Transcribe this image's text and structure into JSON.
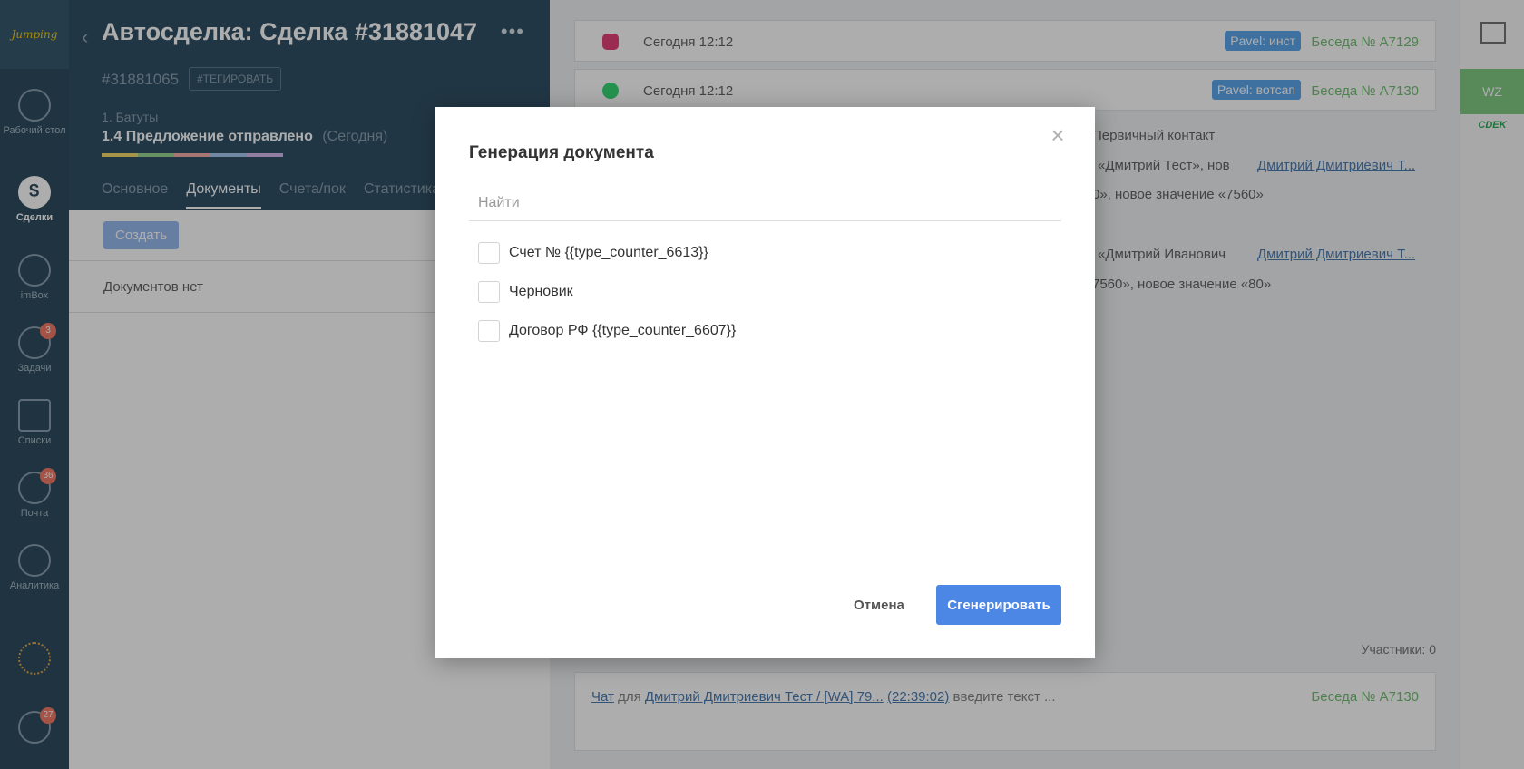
{
  "nav": {
    "logo": "Jumping",
    "items": [
      {
        "label": "Рабочий стол",
        "icon": "dashboard-icon"
      },
      {
        "label": "Сделки",
        "icon": "deals-icon",
        "active": true
      },
      {
        "label": "imBox",
        "icon": "chat-icon"
      },
      {
        "label": "Задачи",
        "icon": "tasks-icon",
        "badge": "3"
      },
      {
        "label": "Списки",
        "icon": "lists-icon"
      },
      {
        "label": "Почта",
        "icon": "mail-icon",
        "badge": "36"
      },
      {
        "label": "Аналитика",
        "icon": "analytics-icon"
      },
      {
        "label": "",
        "icon": "more-icon"
      },
      {
        "label": "",
        "icon": "notifications-icon",
        "badge": "27"
      }
    ]
  },
  "deal": {
    "title": "Автосделка: Сделка #31881047",
    "id": "#31881065",
    "tag_button": "#ТЕГИРОВАТЬ",
    "pipeline": "1. Батуты",
    "stage": "1.4 Предложение отправлено",
    "stage_date": "(Сегодня)",
    "stage_colors": [
      "#f2d55b",
      "#8ed08a",
      "#f4a7a0",
      "#9ec3ef",
      "#d6b3ef"
    ],
    "tabs": [
      "Основное",
      "Документы",
      "Счета/пок",
      "Статистика"
    ],
    "active_tab": "Документы",
    "create_button": "Создать",
    "no_documents": "Документов нет"
  },
  "feed": {
    "rows": [
      {
        "time": "Сегодня 12:12",
        "tag": "Pavel: инст",
        "conversation": "Беседа № A7129",
        "icon": "instagram-icon"
      },
      {
        "time": "Сегодня 12:12",
        "tag": "Pavel: вотсап",
        "conversation": "Беседа № A7130",
        "icon": "whatsapp-icon"
      }
    ],
    "background_texts": {
      "primary_contact": "Первичный контакт",
      "value1": "«Дмитрий Тест», нов",
      "person1": "Дмитрий Дмитриевич Т...",
      "change1": "0», новое значение «7560»",
      "value2": "«Дмитрий Иванович",
      "person2": "Дмитрий Дмитриевич Т...",
      "change2": "7560», новое значение «80»"
    },
    "participants": "Участники: 0",
    "chat": {
      "chat_link": "Чат",
      "for_text": "для",
      "contact_link": "Дмитрий Дмитриевич Тест / [WA] 79...",
      "time_link": "(22:39:02)",
      "placeholder": "введите текст ...",
      "conversation": "Беседа № A7130"
    }
  },
  "rightrail": {
    "wz": "WZ",
    "cdek": "CDEK"
  },
  "modal": {
    "title": "Генерация документа",
    "search_placeholder": "Найти",
    "options": [
      {
        "label": "Счет № {{type_counter_6613}}"
      },
      {
        "label": "Черновик"
      },
      {
        "label": "Договор РФ {{type_counter_6607}}"
      }
    ],
    "cancel_label": "Отмена",
    "generate_label": "Сгенерировать",
    "primary_color": "#4d87e6"
  }
}
